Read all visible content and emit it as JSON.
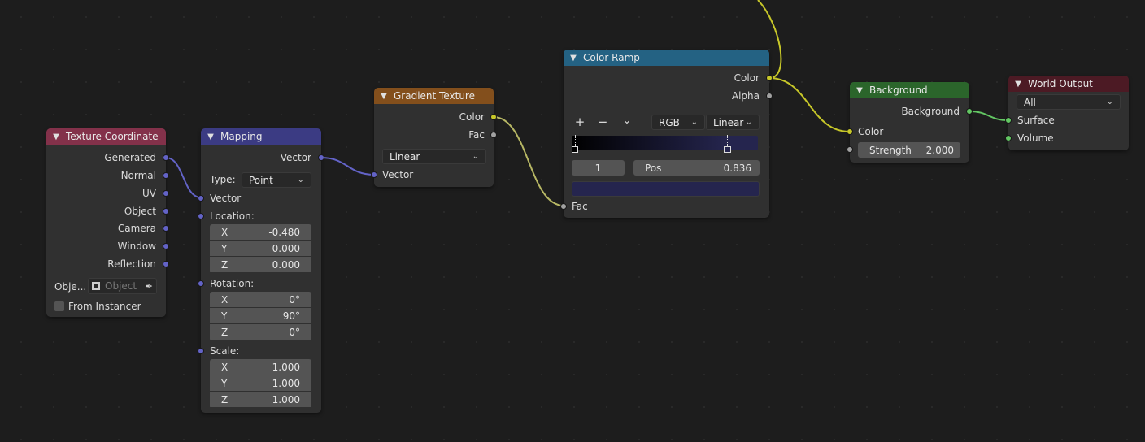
{
  "colors": {
    "vector_socket": "#6363c7",
    "color_socket": "#c7c729",
    "float_socket": "#a1a1a1",
    "shader_socket": "#63c763",
    "header_input": "#83314a",
    "header_vector": "#3b3b83",
    "header_texture": "#834f1c",
    "header_converter": "#246283",
    "header_shader": "#2b652b",
    "header_output": "#4c1a24"
  },
  "texture_coordinate": {
    "title": "Texture Coordinate",
    "outputs": [
      "Generated",
      "Normal",
      "UV",
      "Object",
      "Camera",
      "Window",
      "Reflection"
    ],
    "object_label": "Obje...",
    "object_placeholder": "Object",
    "from_instancer": "From Instancer"
  },
  "mapping": {
    "title": "Mapping",
    "output": "Vector",
    "type_label": "Type:",
    "type_value": "Point",
    "vector_input": "Vector",
    "location_label": "Location:",
    "location": [
      {
        "k": "X",
        "v": "-0.480"
      },
      {
        "k": "Y",
        "v": "0.000"
      },
      {
        "k": "Z",
        "v": "0.000"
      }
    ],
    "rotation_label": "Rotation:",
    "rotation": [
      {
        "k": "X",
        "v": "0°"
      },
      {
        "k": "Y",
        "v": "90°"
      },
      {
        "k": "Z",
        "v": "0°"
      }
    ],
    "scale_label": "Scale:",
    "scale": [
      {
        "k": "X",
        "v": "1.000"
      },
      {
        "k": "Y",
        "v": "1.000"
      },
      {
        "k": "Z",
        "v": "1.000"
      }
    ]
  },
  "gradient_texture": {
    "title": "Gradient Texture",
    "out_color": "Color",
    "out_fac": "Fac",
    "type_value": "Linear",
    "in_vector": "Vector"
  },
  "color_ramp": {
    "title": "Color Ramp",
    "out_color": "Color",
    "out_alpha": "Alpha",
    "add_icon": "+",
    "remove_icon": "−",
    "menu_icon": "⌄",
    "color_mode": "RGB",
    "interpolation": "Linear",
    "stop_index": "1",
    "pos_label": "Pos",
    "pos_value": "0.836",
    "stop_color": "#25254e",
    "ramp_start": "#000000",
    "ramp_end": "#25254e",
    "in_fac": "Fac"
  },
  "background": {
    "title": "Background",
    "out_background": "Background",
    "in_color": "Color",
    "strength_label": "Strength",
    "strength_value": "2.000"
  },
  "world_output": {
    "title": "World Output",
    "target": "All",
    "in_surface": "Surface",
    "in_volume": "Volume"
  }
}
